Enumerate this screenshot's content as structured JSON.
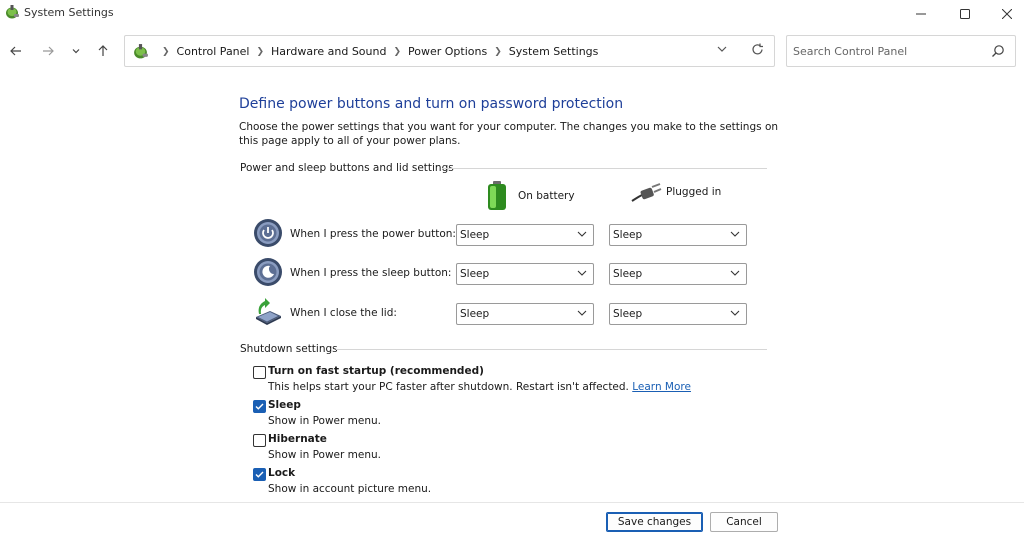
{
  "window": {
    "title": "System Settings"
  },
  "address": {
    "breadcrumbs": [
      "Control Panel",
      "Hardware and Sound",
      "Power Options",
      "System Settings"
    ]
  },
  "search": {
    "placeholder": "Search Control Panel"
  },
  "page": {
    "title": "Define power buttons and turn on password protection",
    "description": "Choose the power settings that you want for your computer. The changes you make to the settings on this page apply to all of your power plans."
  },
  "power_section": {
    "header": "Power and sleep buttons and lid settings",
    "col_battery": "On battery",
    "col_plugged": "Plugged in",
    "rows": [
      {
        "label": "When I press the power button:",
        "battery": "Sleep",
        "plugged": "Sleep"
      },
      {
        "label": "When I press the sleep button:",
        "battery": "Sleep",
        "plugged": "Sleep"
      },
      {
        "label": "When I close the lid:",
        "battery": "Sleep",
        "plugged": "Sleep"
      }
    ]
  },
  "shutdown_section": {
    "header": "Shutdown settings",
    "options": [
      {
        "label": "Turn on fast startup (recommended)",
        "desc": "This helps start your PC faster after shutdown. Restart isn't affected.",
        "link": "Learn More",
        "checked": false
      },
      {
        "label": "Sleep",
        "desc": "Show in Power menu.",
        "checked": true
      },
      {
        "label": "Hibernate",
        "desc": "Show in Power menu.",
        "checked": false
      },
      {
        "label": "Lock",
        "desc": "Show in account picture menu.",
        "checked": true
      }
    ]
  },
  "buttons": {
    "save": "Save changes",
    "cancel": "Cancel"
  },
  "colors": {
    "title_blue": "#1e3f99",
    "accent": "#1a5fb4"
  }
}
